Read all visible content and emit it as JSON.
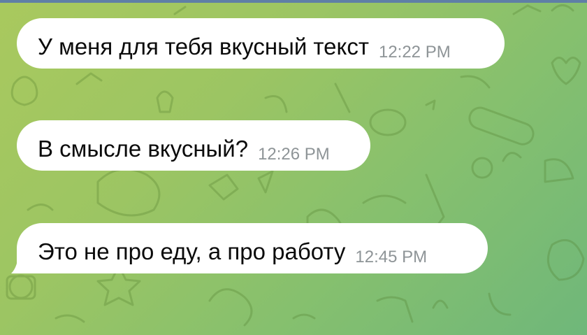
{
  "chat": {
    "background_color": "#9cc563",
    "messages": [
      {
        "text": "У меня для тебя вкусный текст",
        "time": "12:22 PM"
      },
      {
        "text": "В смысле вкусный?",
        "time": "12:26 PM"
      },
      {
        "text": "Это не про еду, а про работу",
        "time": "12:45 PM"
      }
    ]
  }
}
